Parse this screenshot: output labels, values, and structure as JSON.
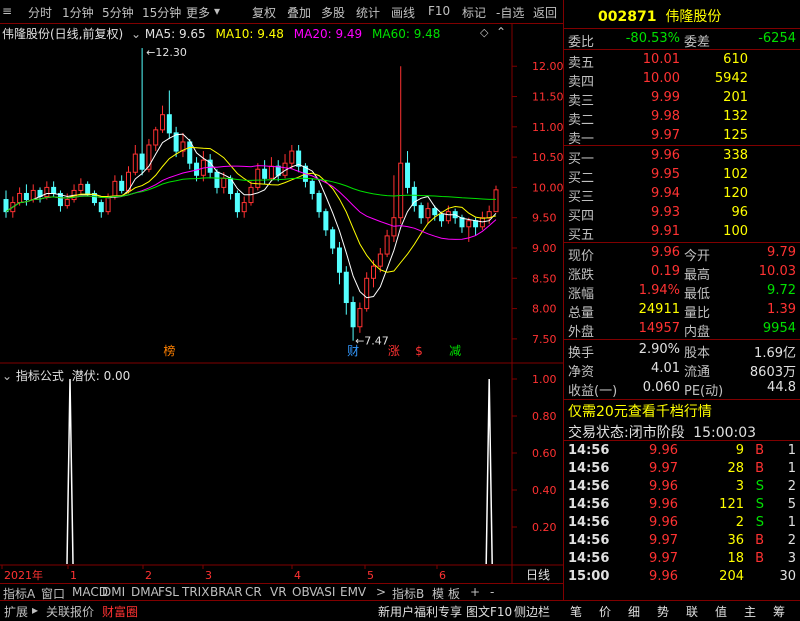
{
  "toolbar": {
    "periods": [
      "分时",
      "1分钟",
      "5分钟",
      "15分钟",
      "更多"
    ],
    "actions": [
      "复权",
      "叠加",
      "多股",
      "统计",
      "画线",
      "F10",
      "标记",
      "-自选",
      "返回"
    ]
  },
  "header": {
    "stock_name": "伟隆股份(日线,前复权)",
    "ma5_label": "MA5: 9.65",
    "ma10_label": "MA10: 9.48",
    "ma20_label": "MA20: 9.49",
    "ma60_label": "MA60: 9.48"
  },
  "chart_data": {
    "type": "candlestick",
    "y_range": [
      7.3,
      12.4
    ],
    "y_ticks": [
      "12.00",
      "11.50",
      "11.00",
      "10.50",
      "10.00",
      "9.50",
      "9.00",
      "8.50",
      "8.00",
      "7.50"
    ],
    "high_marker": "12.30",
    "low_marker": "7.47",
    "event_markers": [
      "榜",
      "财",
      "涨",
      "$",
      "减"
    ],
    "x_labels": [
      "2021年",
      "1",
      "2",
      "3",
      "4",
      "5",
      "6"
    ],
    "candles": [
      [
        9.8,
        9.6,
        9.95,
        9.5
      ],
      [
        9.6,
        9.75,
        9.85,
        9.5
      ],
      [
        9.75,
        9.9,
        10.0,
        9.7
      ],
      [
        9.9,
        9.8,
        10.05,
        9.7
      ],
      [
        9.8,
        9.95,
        10.05,
        9.75
      ],
      [
        9.95,
        9.85,
        10.0,
        9.75
      ],
      [
        9.85,
        10.0,
        10.1,
        9.8
      ],
      [
        10.0,
        9.9,
        10.1,
        9.85
      ],
      [
        9.9,
        9.7,
        9.95,
        9.6
      ],
      [
        9.7,
        9.8,
        9.9,
        9.65
      ],
      [
        9.8,
        9.95,
        10.05,
        9.75
      ],
      [
        9.95,
        10.05,
        10.15,
        9.9
      ],
      [
        10.05,
        9.9,
        10.1,
        9.85
      ],
      [
        9.9,
        9.75,
        9.95,
        9.7
      ],
      [
        9.75,
        9.6,
        9.8,
        9.5
      ],
      [
        9.6,
        9.85,
        9.9,
        9.55
      ],
      [
        9.85,
        10.1,
        10.2,
        9.8
      ],
      [
        10.1,
        9.95,
        10.2,
        9.9
      ],
      [
        9.95,
        10.25,
        10.35,
        9.9
      ],
      [
        10.25,
        10.55,
        10.7,
        10.2
      ],
      [
        10.55,
        10.3,
        12.3,
        10.2
      ],
      [
        10.3,
        10.7,
        10.8,
        10.25
      ],
      [
        10.7,
        10.95,
        11.0,
        10.6
      ],
      [
        10.95,
        11.2,
        11.35,
        10.9
      ],
      [
        11.2,
        10.9,
        11.6,
        10.8
      ],
      [
        10.9,
        10.6,
        11.0,
        10.5
      ],
      [
        10.6,
        10.75,
        10.9,
        10.5
      ],
      [
        10.75,
        10.4,
        10.8,
        10.3
      ],
      [
        10.4,
        10.2,
        10.5,
        10.1
      ],
      [
        10.2,
        10.45,
        10.6,
        10.1
      ],
      [
        10.45,
        10.25,
        10.55,
        10.15
      ],
      [
        10.25,
        10.0,
        10.3,
        9.9
      ],
      [
        10.0,
        10.15,
        10.25,
        9.9
      ],
      [
        10.15,
        9.9,
        10.2,
        9.8
      ],
      [
        9.9,
        9.6,
        9.95,
        9.5
      ],
      [
        9.6,
        9.75,
        9.85,
        9.5
      ],
      [
        9.75,
        10.0,
        10.1,
        9.7
      ],
      [
        10.0,
        10.3,
        10.4,
        9.95
      ],
      [
        10.3,
        10.15,
        10.45,
        10.05
      ],
      [
        10.15,
        10.35,
        10.5,
        10.1
      ],
      [
        10.35,
        10.2,
        10.45,
        10.1
      ],
      [
        10.2,
        10.4,
        10.55,
        10.15
      ],
      [
        10.4,
        10.6,
        10.7,
        10.3
      ],
      [
        10.6,
        10.35,
        10.7,
        10.25
      ],
      [
        10.35,
        10.1,
        10.4,
        10.0
      ],
      [
        10.1,
        9.9,
        10.15,
        9.8
      ],
      [
        9.9,
        9.6,
        9.95,
        9.5
      ],
      [
        9.6,
        9.3,
        9.65,
        9.2
      ],
      [
        9.3,
        9.0,
        9.35,
        8.9
      ],
      [
        9.0,
        8.6,
        9.1,
        8.4
      ],
      [
        8.6,
        8.1,
        8.7,
        7.9
      ],
      [
        8.1,
        7.7,
        8.2,
        7.47
      ],
      [
        7.7,
        8.0,
        8.1,
        7.6
      ],
      [
        8.0,
        8.5,
        8.6,
        7.95
      ],
      [
        8.5,
        8.7,
        8.8,
        8.35
      ],
      [
        8.7,
        8.9,
        9.0,
        8.6
      ],
      [
        8.9,
        9.2,
        9.3,
        8.85
      ],
      [
        9.2,
        9.5,
        10.2,
        9.1
      ],
      [
        9.5,
        10.4,
        12.0,
        9.4
      ],
      [
        10.4,
        10.0,
        10.6,
        9.9
      ],
      [
        10.0,
        9.7,
        10.1,
        9.6
      ],
      [
        9.7,
        9.5,
        9.75,
        9.4
      ],
      [
        9.5,
        9.65,
        9.75,
        9.4
      ],
      [
        9.65,
        9.55,
        9.7,
        9.45
      ],
      [
        9.55,
        9.45,
        9.6,
        9.35
      ],
      [
        9.45,
        9.6,
        9.7,
        9.4
      ],
      [
        9.6,
        9.5,
        9.65,
        9.4
      ],
      [
        9.5,
        9.35,
        9.55,
        9.25
      ],
      [
        9.35,
        9.45,
        9.5,
        9.1
      ],
      [
        9.45,
        9.35,
        9.5,
        9.2
      ],
      [
        9.35,
        9.5,
        9.6,
        9.3
      ],
      [
        9.5,
        9.6,
        9.7,
        9.4
      ],
      [
        9.6,
        9.96,
        10.03,
        9.6
      ]
    ],
    "indicator": {
      "label": "指标公式",
      "series_label": "潜伏: 0.00",
      "y_ticks": [
        "1.00",
        "0.80",
        "0.60",
        "0.40",
        "0.20"
      ],
      "spikes": [
        {
          "index": 10,
          "value": 1.0
        },
        {
          "index": 71,
          "value": 1.0
        }
      ]
    },
    "period_label": "日线"
  },
  "indicator_tabs": [
    "指标A",
    "窗口",
    "MACD",
    "DMI",
    "DMA",
    "FSL",
    "TRIX",
    "BRAR",
    "CR",
    "VR",
    "OBV",
    "ASI",
    "EMV",
    ">",
    "指标B",
    "模",
    "板",
    "+",
    "-"
  ],
  "bottom_tabs": [
    "扩展",
    "关联报价",
    "财富圈"
  ],
  "bottom_right": [
    "新用户福利专享",
    "图文F10",
    "侧边栏"
  ],
  "bottom_icons": [
    "笔",
    "价",
    "细",
    "势",
    "联",
    "值",
    "主",
    "筹"
  ],
  "quote": {
    "code": "002871",
    "name": "伟隆股份",
    "weibi_label": "委比",
    "weibi": "-80.53%",
    "weicha_label": "委差",
    "weicha": "-6254",
    "sells": [
      {
        "label": "卖五",
        "price": "10.01",
        "vol": "610"
      },
      {
        "label": "卖四",
        "price": "10.00",
        "vol": "5942"
      },
      {
        "label": "卖三",
        "price": "9.99",
        "vol": "201"
      },
      {
        "label": "卖二",
        "price": "9.98",
        "vol": "132"
      },
      {
        "label": "卖一",
        "price": "9.97",
        "vol": "125"
      }
    ],
    "buys": [
      {
        "label": "买一",
        "price": "9.96",
        "vol": "338"
      },
      {
        "label": "买二",
        "price": "9.95",
        "vol": "102"
      },
      {
        "label": "买三",
        "price": "9.94",
        "vol": "120"
      },
      {
        "label": "买四",
        "price": "9.93",
        "vol": "96"
      },
      {
        "label": "买五",
        "price": "9.91",
        "vol": "100"
      }
    ],
    "stats": [
      {
        "l1": "现价",
        "v1": "9.96",
        "c1": "red",
        "l2": "今开",
        "v2": "9.79",
        "c2": "red"
      },
      {
        "l1": "涨跌",
        "v1": "0.19",
        "c1": "red",
        "l2": "最高",
        "v2": "10.03",
        "c2": "red"
      },
      {
        "l1": "涨幅",
        "v1": "1.94%",
        "c1": "red",
        "l2": "最低",
        "v2": "9.72",
        "c2": "green"
      },
      {
        "l1": "总量",
        "v1": "24911",
        "c1": "yellow",
        "l2": "量比",
        "v2": "1.39",
        "c2": "red"
      },
      {
        "l1": "外盘",
        "v1": "14957",
        "c1": "red",
        "l2": "内盘",
        "v2": "9954",
        "c2": "green"
      }
    ],
    "stats2": [
      {
        "l1": "换手",
        "v1": "2.90%",
        "l2": "股本",
        "v2": "1.69亿"
      },
      {
        "l1": "净资",
        "v1": "4.01",
        "l2": "流通",
        "v2": "8603万"
      },
      {
        "l1": "收益(一)",
        "v1": "0.060",
        "l2": "PE(动)",
        "v2": "44.8"
      }
    ],
    "promo": "仅需20元查看千档行情",
    "trade_status_label": "交易状态:",
    "trade_status": "闭市阶段",
    "trade_time": "15:00:03"
  },
  "ticks": [
    {
      "time": "14:56",
      "price": "9.96",
      "vol": "9",
      "side": "B",
      "n": "1"
    },
    {
      "time": "14:56",
      "price": "9.97",
      "vol": "28",
      "side": "B",
      "n": "1"
    },
    {
      "time": "14:56",
      "price": "9.96",
      "vol": "3",
      "side": "S",
      "n": "2"
    },
    {
      "time": "14:56",
      "price": "9.96",
      "vol": "121",
      "side": "S",
      "n": "5"
    },
    {
      "time": "14:56",
      "price": "9.96",
      "vol": "2",
      "side": "S",
      "n": "1"
    },
    {
      "time": "14:56",
      "price": "9.97",
      "vol": "36",
      "side": "B",
      "n": "2"
    },
    {
      "time": "14:56",
      "price": "9.97",
      "vol": "18",
      "side": "B",
      "n": "3"
    },
    {
      "time": "15:00",
      "price": "9.96",
      "vol": "204",
      "side": "",
      "n": "30"
    }
  ],
  "colors": {
    "up": "#ff3232",
    "down": "#54ffff",
    "ma5": "#ffffff",
    "ma10": "#ffff00",
    "ma20": "#ff00ff",
    "ma60": "#00e000",
    "grid": "#800000"
  }
}
